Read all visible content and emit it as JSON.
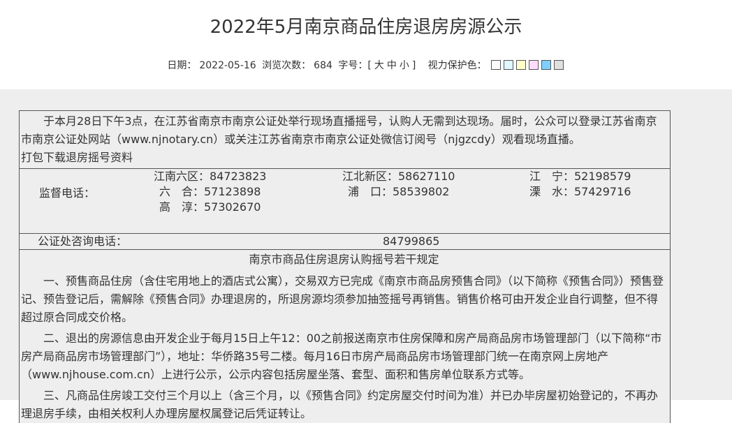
{
  "title": "2022年5月南京商品住房退房房源公示",
  "meta": {
    "date_label": "日期：",
    "date": "2022-05-16",
    "views_label": "浏览次数：",
    "views": "684",
    "font_label": "字号：[",
    "size_large": "大",
    "size_medium": "中",
    "size_small": "小",
    "font_close": "]",
    "eye_label": "视力保护色：",
    "swatches": [
      "#FAFAFA",
      "#E0F8FF",
      "#FFFFCC",
      "#FFDDFF",
      "#7FD0FF",
      "#E0E0E0"
    ]
  },
  "intro": {
    "text": "于本月28日下午3点，在江苏省南京市南京公证处举行现场直播摇号，认购人无需到达现场。届时，公众可以登录江苏省南京市南京公证处网站（www.njnotary.cn）或关注江苏省南京市南京公证处微信订阅号（njgzcdy）观看现场直播。",
    "download": "打包下载退房摇号资料"
  },
  "phones": {
    "label": "监督电话：",
    "items": [
      "江南六区：84723823",
      "江北新区：58627110",
      "江　宁：52198579",
      "六　合：57123898",
      "浦　口：58539802",
      "溧　水：57429716",
      "高　淳：57302670"
    ]
  },
  "consult": {
    "label": "公证处咨询电话：",
    "number": "84799865"
  },
  "rules": {
    "heading": "南京市商品住房退房认购摇号若干规定",
    "paragraphs": [
      "一、预售商品住房（含住宅用地上的酒店式公寓），交易双方已完成《南京市商品房预售合同》（以下简称《预售合同》）预售登记、预告登记后，需解除《预售合同》办理退房的，所退房源均须参加抽签摇号再销售。销售价格可由开发企业自行调整，但不得超过原合同成交价格。",
      "二、退出的房源信息由开发企业于每月15日上午12：00之前报送南京市住房保障和房产局商品房市场管理部门（以下简称“市房产局商品房市场管理部门”），地址：华侨路35号二楼。每月16日市房产局商品房市场管理部门统一在南京网上房地产（www.njhouse.com.cn）上进行公示，公示内容包括房屋坐落、套型、面积和售房单位联系方式等。",
      "三、凡商品住房竣工交付三个月以上（含三个月，以《预售合同》约定房屋交付时间为准）并已办毕房屋初始登记的，不再办理退房手续，由相关权利人办理房屋权属登记后凭证转让。"
    ]
  }
}
